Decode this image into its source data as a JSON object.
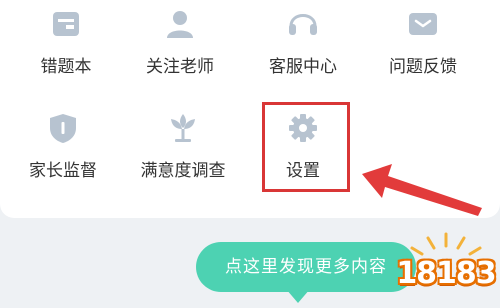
{
  "menu": {
    "row1": [
      {
        "label": "错题本",
        "icon": "notebook-icon"
      },
      {
        "label": "关注老师",
        "icon": "person-icon"
      },
      {
        "label": "客服中心",
        "icon": "headset-icon"
      },
      {
        "label": "问题反馈",
        "icon": "message-icon"
      }
    ],
    "row2": [
      {
        "label": "家长监督",
        "icon": "shield-icon"
      },
      {
        "label": "满意度调查",
        "icon": "flower-icon"
      },
      {
        "label": "设置",
        "icon": "gear-icon"
      }
    ]
  },
  "tooltip": {
    "text": "点这里发现更多内容"
  },
  "watermark": {
    "text": "18183"
  },
  "colors": {
    "icon": "#b7c3d0",
    "label": "#333333",
    "highlight": "#d93636",
    "arrow": "#e23b3b",
    "bubble": "#4dd2b2",
    "watermark": "#e76f00"
  }
}
